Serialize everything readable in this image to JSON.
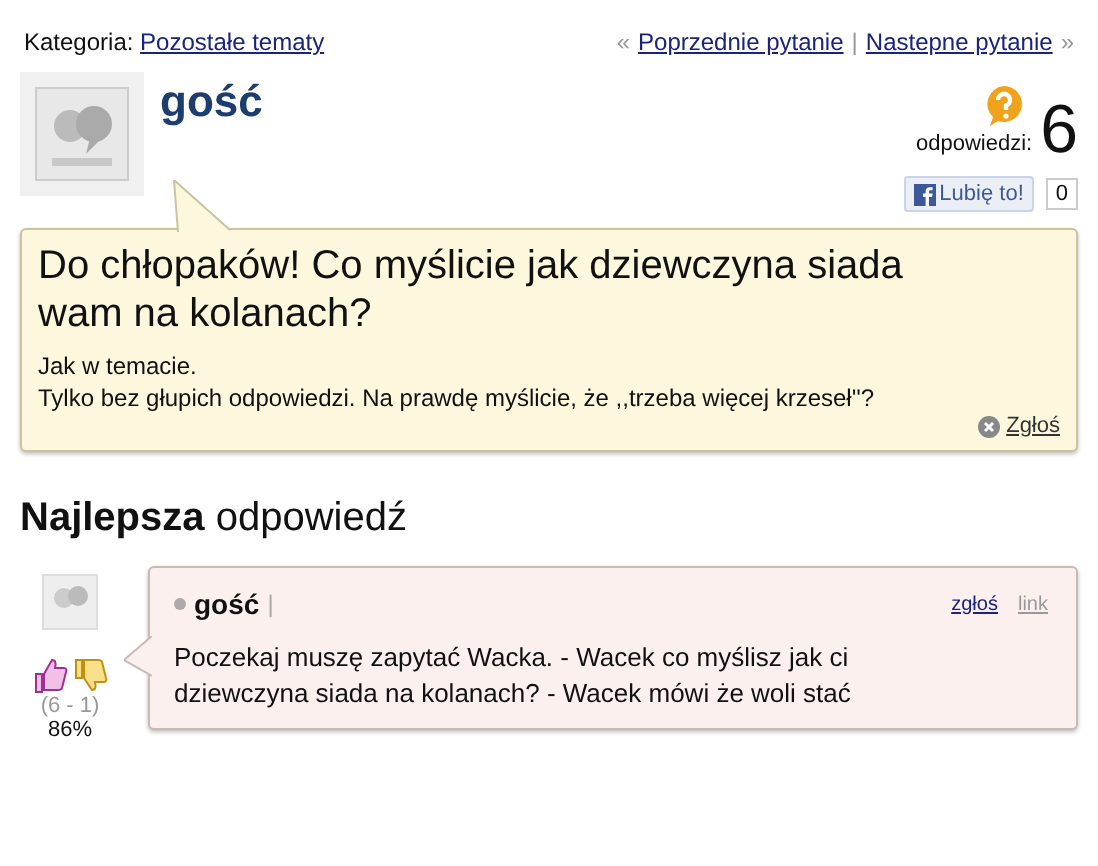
{
  "category": {
    "label": "Kategoria:",
    "value": "Pozostałe tematy"
  },
  "nav": {
    "prev_mark": "«",
    "prev": "Poprzednie pytanie",
    "separator": "|",
    "next": "Nastepne pytanie",
    "next_mark": "»"
  },
  "author": {
    "name": "gość"
  },
  "answers_count": {
    "label": "odpowiedzi:",
    "value": "6"
  },
  "like": {
    "label": "Lubię to!",
    "count": "0"
  },
  "question": {
    "title": "Do chłopaków! Co myślicie jak dziewczyna siada wam na kolanach?",
    "body": [
      "Jak w temacie.",
      "Tylko bez głupich odpowiedzi. Na prawdę myślicie, że ,,trzeba więcej krzeseł''?"
    ],
    "report": "Zgłoś"
  },
  "best_answer": {
    "heading_bold": "Najlepsza",
    "heading_rest": "odpowiedź",
    "votes": "(6 - 1)",
    "percent": "86%",
    "author": "gość",
    "separator": "|",
    "report": "zgłoś",
    "link": "link",
    "text": "Poczekaj muszę zapytać Wacka. - Wacek co myślisz jak ci dziewczyna siada na kolanach? - Wacek mówi że woli stać"
  }
}
